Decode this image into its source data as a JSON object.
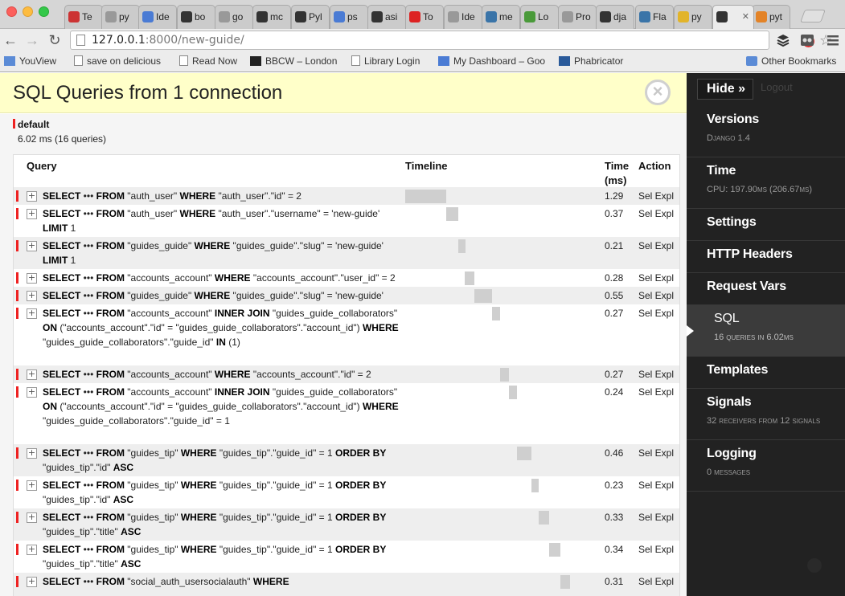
{
  "browser": {
    "tabs": [
      {
        "label": "Te",
        "icon": "bookmark-tab-icon",
        "color": "#c33"
      },
      {
        "label": "py",
        "icon": "page-icon",
        "color": "#999"
      },
      {
        "label": "Ide",
        "icon": "google-icon",
        "color": "#4a7bd4"
      },
      {
        "label": "bo",
        "icon": "github-icon",
        "color": "#333"
      },
      {
        "label": "go",
        "icon": "page-icon",
        "color": "#999"
      },
      {
        "label": "mc",
        "icon": "github-icon",
        "color": "#333"
      },
      {
        "label": "Pyl",
        "icon": "github-icon",
        "color": "#333"
      },
      {
        "label": "ps",
        "icon": "google-icon",
        "color": "#4a7bd4"
      },
      {
        "label": "asi",
        "icon": "github-icon",
        "color": "#333"
      },
      {
        "label": "To",
        "icon": "tomato-icon",
        "color": "#d22"
      },
      {
        "label": "Ide",
        "icon": "page-icon",
        "color": "#999"
      },
      {
        "label": "me",
        "icon": "python-icon",
        "color": "#3a74a8"
      },
      {
        "label": "Lo",
        "icon": "maps-icon",
        "color": "#4a9a3a"
      },
      {
        "label": "Pro",
        "icon": "page-icon",
        "color": "#999"
      },
      {
        "label": "dja",
        "icon": "github-icon",
        "color": "#333"
      },
      {
        "label": "Fla",
        "icon": "python-icon",
        "color": "#3a74a8"
      },
      {
        "label": "py",
        "icon": "drive-icon",
        "color": "#e2b42a"
      },
      {
        "label": "",
        "icon": "ddt-icon",
        "color": "#333",
        "active": true
      },
      {
        "label": "pyt",
        "icon": "stackoverflow-icon",
        "color": "#e38327"
      }
    ],
    "url_host": "127.0.0.1",
    "url_path": ":8000/new-guide/",
    "bookmarks": [
      {
        "label": "YouView",
        "icon": "folder"
      },
      {
        "label": "save on delicious",
        "icon": "page"
      },
      {
        "label": "Read Now",
        "icon": "page"
      },
      {
        "label": "BBCW – London",
        "icon": "bbc"
      },
      {
        "label": "Library Login",
        "icon": "page"
      },
      {
        "label": "My Dashboard – Goo",
        "icon": "google"
      },
      {
        "label": "Phabricator",
        "icon": "phab"
      }
    ],
    "other_bookmarks": "Other Bookmarks"
  },
  "panel": {
    "title": "SQL Queries from 1 connection",
    "connection_name": "default",
    "connection_stats": "6.02 ms (16 queries)",
    "headers": {
      "query": "Query",
      "timeline": "Timeline",
      "time": "Time (ms)",
      "action": "Action"
    },
    "queries": [
      {
        "sql": "<b>SELECT</b> ••• <b>FROM</b> \"auth_user\" <b>WHERE</b> \"auth_user\".\"id\" = 2",
        "time": "1.29",
        "action": "Sel Expl",
        "start": 0.0,
        "width": 0.214
      },
      {
        "sql": "<b>SELECT</b> ••• <b>FROM</b> \"auth_user\" <b>WHERE</b> \"auth_user\".\"username\" = 'new-guide' <b>LIMIT</b> 1",
        "time": "0.37",
        "action": "Sel Expl",
        "start": 0.214,
        "width": 0.061
      },
      {
        "sql": "<b>SELECT</b> ••• <b>FROM</b> \"guides_guide\" <b>WHERE</b> \"guides_guide\".\"slug\" = 'new-guide' <b>LIMIT</b> 1",
        "time": "0.21",
        "action": "Sel Expl",
        "start": 0.275,
        "width": 0.035
      },
      {
        "sql": "<b>SELECT</b> ••• <b>FROM</b> \"accounts_account\" <b>WHERE</b> \"accounts_account\".\"user_id\" = 2",
        "time": "0.28",
        "action": "Sel Expl",
        "start": 0.31,
        "width": 0.047
      },
      {
        "sql": "<b>SELECT</b> ••• <b>FROM</b> \"guides_guide\" <b>WHERE</b> \"guides_guide\".\"slug\" = 'new-guide'",
        "time": "0.55",
        "action": "Sel Expl",
        "start": 0.357,
        "width": 0.091
      },
      {
        "sql": "<b>SELECT</b> ••• <b>FROM</b> \"accounts_account\" <b>INNER JOIN</b> \"guides_guide_collaborators\" <b>ON</b> (\"accounts_account\".\"id\" = \"guides_guide_collaborators\".\"account_id\") <b>WHERE</b> \"guides_guide_collaborators\".\"guide_id\" <b>IN</b> (1)",
        "time": "0.27",
        "action": "Sel Expl",
        "start": 0.448,
        "width": 0.045
      },
      {
        "sql": "<b>SELECT</b> ••• <b>FROM</b> \"accounts_account\" <b>WHERE</b> \"accounts_account\".\"id\" = 2",
        "time": "0.27",
        "action": "Sel Expl",
        "start": 0.493,
        "width": 0.045
      },
      {
        "sql": "<b>SELECT</b> ••• <b>FROM</b> \"accounts_account\" <b>INNER JOIN</b> \"guides_guide_collaborators\" <b>ON</b> (\"accounts_account\".\"id\" = \"guides_guide_collaborators\".\"account_id\") <b>WHERE</b> \"guides_guide_collaborators\".\"guide_id\" = 1",
        "time": "0.24",
        "action": "Sel Expl",
        "start": 0.538,
        "width": 0.04
      },
      {
        "sql": "<b>SELECT</b> ••• <b>FROM</b> \"guides_tip\" <b>WHERE</b> \"guides_tip\".\"guide_id\" = 1 <b>ORDER BY</b> \"guides_tip\".\"id\" <b>ASC</b>",
        "time": "0.46",
        "action": "Sel Expl",
        "start": 0.578,
        "width": 0.076
      },
      {
        "sql": "<b>SELECT</b> ••• <b>FROM</b> \"guides_tip\" <b>WHERE</b> \"guides_tip\".\"guide_id\" = 1 <b>ORDER BY</b> \"guides_tip\".\"id\" <b>ASC</b>",
        "time": "0.23",
        "action": "Sel Expl",
        "start": 0.654,
        "width": 0.038
      },
      {
        "sql": "<b>SELECT</b> ••• <b>FROM</b> \"guides_tip\" <b>WHERE</b> \"guides_tip\".\"guide_id\" = 1 <b>ORDER BY</b> \"guides_tip\".\"title\" <b>ASC</b>",
        "time": "0.33",
        "action": "Sel Expl",
        "start": 0.692,
        "width": 0.055
      },
      {
        "sql": "<b>SELECT</b> ••• <b>FROM</b> \"guides_tip\" <b>WHERE</b> \"guides_tip\".\"guide_id\" = 1 <b>ORDER BY</b> \"guides_tip\".\"title\" <b>ASC</b>",
        "time": "0.34",
        "action": "Sel Expl",
        "start": 0.747,
        "width": 0.056
      },
      {
        "sql": "<b>SELECT</b> ••• <b>FROM</b> \"social_auth_usersocialauth\" <b>WHERE</b>",
        "time": "0.31",
        "action": "Sel Expl",
        "start": 0.803,
        "width": 0.051
      }
    ]
  },
  "sidebar": {
    "hide_label": "Hide »",
    "logout_label": "Logout",
    "items": [
      {
        "title": "Versions",
        "sub": "Django 1.4"
      },
      {
        "title": "Time",
        "sub": "CPU: 197.90ms (206.67ms)"
      },
      {
        "title": "Settings",
        "sub": ""
      },
      {
        "title": "HTTP Headers",
        "sub": ""
      },
      {
        "title": "Request Vars",
        "sub": ""
      },
      {
        "title": "SQL",
        "sub": "16 queries in 6.02ms",
        "active": true
      },
      {
        "title": "Templates",
        "sub": ""
      },
      {
        "title": "Signals",
        "sub": "32 receivers from 12 signals"
      },
      {
        "title": "Logging",
        "sub": "0 messages"
      }
    ]
  }
}
